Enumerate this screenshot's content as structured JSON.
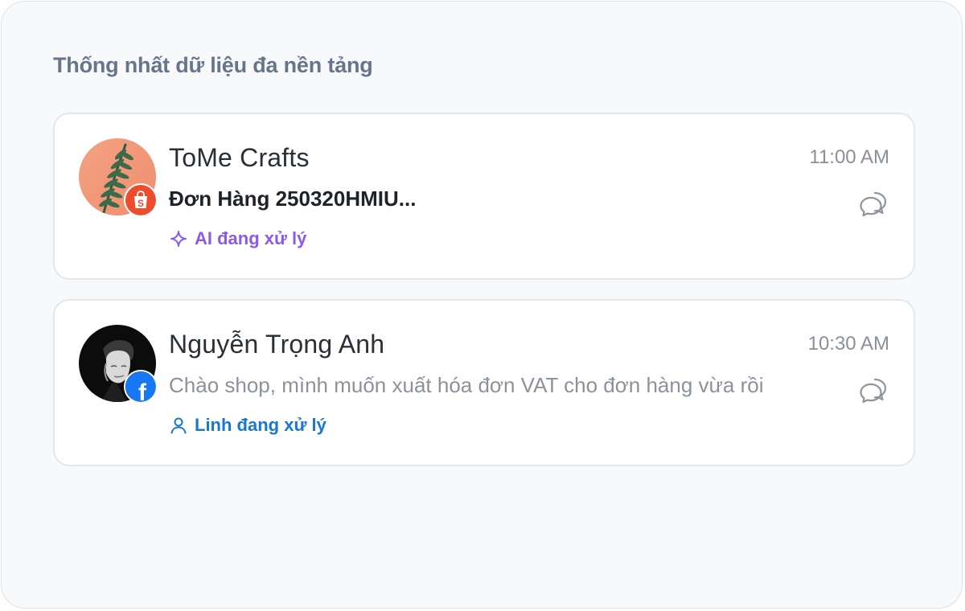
{
  "panel": {
    "title": "Thống nhất dữ liệu đa nền tảng"
  },
  "conversations": [
    {
      "name": "ToMe Crafts",
      "message": "Đơn Hàng 250320HMIU...",
      "time": "11:00 AM",
      "status": "AI đang xử lý",
      "status_icon": "sparkle-icon",
      "platform": "shopee",
      "platform_icon": "shopee-bag-icon",
      "platform_glyph": "S",
      "status_color": "#8a5be8",
      "platform_color": "#ee4d2d"
    },
    {
      "name": "Nguyễn Trọng Anh",
      "message": "Chào shop, mình muốn xuất hóa đơn VAT cho đơn hàng vừa rồi",
      "time": "10:30 AM",
      "status": "Linh đang xử lý",
      "status_icon": "user-icon",
      "platform": "facebook",
      "platform_icon": "facebook-icon",
      "platform_glyph": "f",
      "status_color": "#1a77cf",
      "platform_color": "#1877f2"
    }
  ]
}
